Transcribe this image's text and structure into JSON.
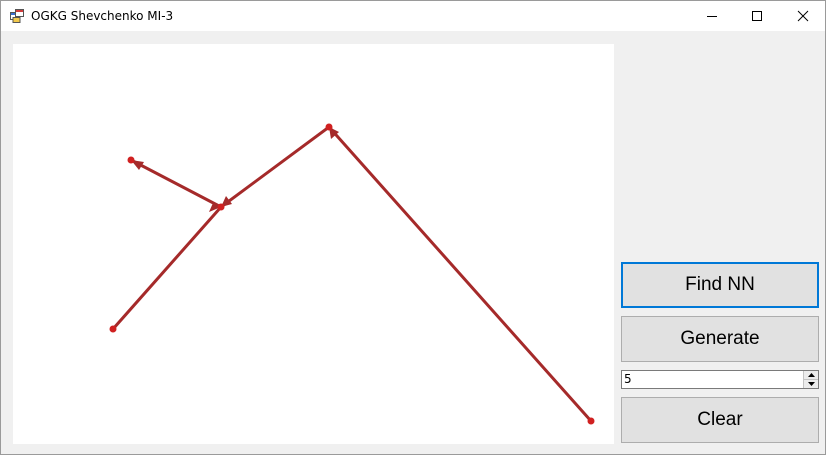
{
  "window": {
    "title": "OGKG Shevchenko MI-3",
    "icon": "app-window-icon"
  },
  "caption_buttons": {
    "minimize_icon": "minimize-icon",
    "maximize_icon": "maximize-icon",
    "close_icon": "close-icon"
  },
  "controls": {
    "find_nn_label": "Find NN",
    "generate_label": "Generate",
    "count_value": "5",
    "clear_label": "Clear"
  },
  "colors": {
    "edge": "#a52a2a",
    "point": "#d02020",
    "focus_border": "#0078d7"
  }
}
